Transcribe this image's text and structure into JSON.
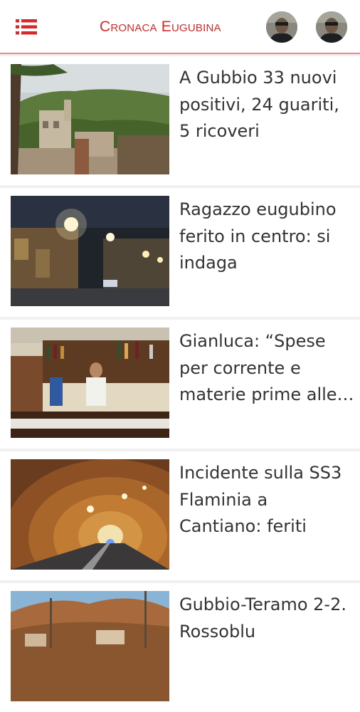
{
  "header": {
    "app_title": "Cronaca Eugubina",
    "menu_icon": "hamburger-menu-icon",
    "accent_color": "#d42a2a"
  },
  "articles": [
    {
      "title": "A Gubbio 33 nuovi positivi, 24 guariti, 5 ricoveri"
    },
    {
      "title": "Ragazzo eugubino ferito in centro: si indaga"
    },
    {
      "title": "Gianluca: “Spese per corrente e materie prime alle stelle”"
    },
    {
      "title": "Incidente sulla SS3 Flaminia a Cantiano: feriti"
    },
    {
      "title": "Gubbio-Teramo 2-2. Rossoblu"
    }
  ]
}
